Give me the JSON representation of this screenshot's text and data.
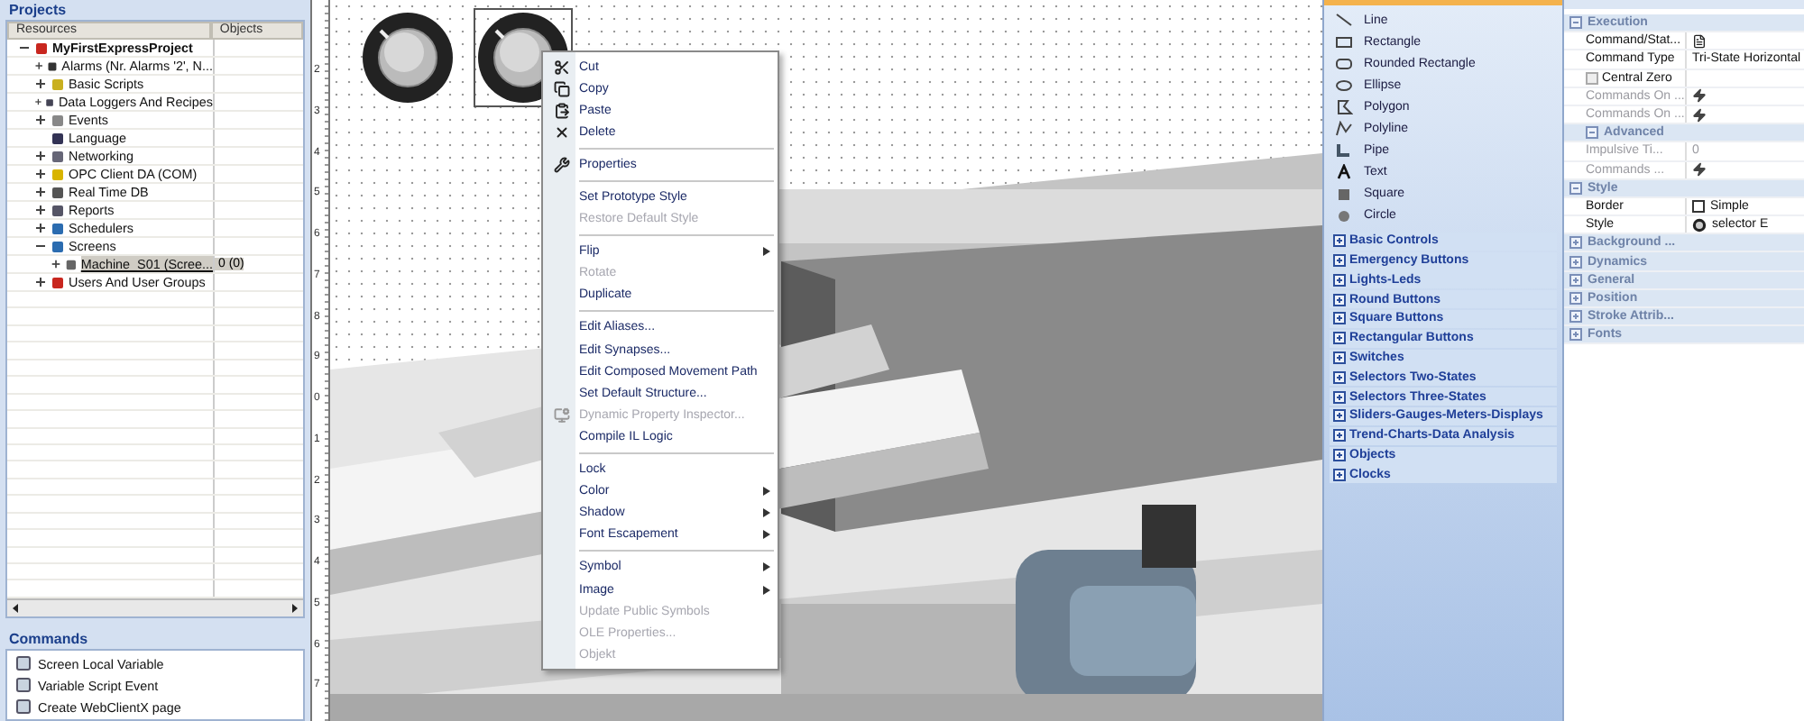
{
  "projects": {
    "title": "Projects",
    "columns": [
      "Resources",
      "Objects"
    ],
    "tree": {
      "label": "MyFirstExpressProject",
      "expanded": true,
      "children": [
        {
          "label": "Alarms (Nr. Alarms '2', N...",
          "expanded": false
        },
        {
          "label": "Basic Scripts",
          "expanded": false
        },
        {
          "label": "Data Loggers And Recipes",
          "expanded": false
        },
        {
          "label": "Events",
          "expanded": false
        },
        {
          "label": "Language"
        },
        {
          "label": "Networking",
          "expanded": false
        },
        {
          "label": "OPC Client DA (COM)",
          "expanded": false
        },
        {
          "label": "Real Time DB",
          "expanded": false
        },
        {
          "label": "Reports",
          "expanded": false
        },
        {
          "label": "Schedulers",
          "expanded": false
        },
        {
          "label": "Screens",
          "expanded": true,
          "children": [
            {
              "label": "Machine_S01 (Scree...",
              "objects": "0 (0)",
              "expanded": false,
              "selected": true
            }
          ]
        },
        {
          "label": "Users And User Groups",
          "expanded": false
        }
      ]
    }
  },
  "commands": {
    "title": "Commands",
    "items": [
      "Screen Local Variable",
      "Variable Script Event",
      "Create WebClientX page"
    ]
  },
  "ruler": [
    "2",
    "3",
    "4",
    "5",
    "6",
    "7",
    "8",
    "9",
    "0",
    "1",
    "2",
    "3",
    "4",
    "5",
    "6",
    "7"
  ],
  "canvas": {
    "knobs": [
      {
        "selected": false
      },
      {
        "selected": true
      }
    ]
  },
  "context_menu": [
    [
      {
        "label": "Cut",
        "disabled": false
      },
      {
        "label": "Copy",
        "disabled": false
      },
      {
        "label": "Paste",
        "disabled": false
      },
      {
        "label": "Delete",
        "disabled": false
      }
    ],
    [
      {
        "label": "Properties",
        "disabled": false
      }
    ],
    [
      {
        "label": "Set Prototype Style",
        "disabled": false
      },
      {
        "label": "Restore Default Style",
        "disabled": true
      }
    ],
    [
      {
        "label": "Flip",
        "disabled": false,
        "submenu": true
      },
      {
        "label": "Rotate",
        "disabled": true
      },
      {
        "label": "Duplicate",
        "disabled": false
      }
    ],
    [
      {
        "label": "Edit Aliases...",
        "disabled": false
      },
      {
        "label": "Edit Synapses...",
        "disabled": false
      },
      {
        "label": "Edit Composed Movement Path",
        "disabled": false
      },
      {
        "label": "Set Default Structure...",
        "disabled": false
      },
      {
        "label": "Dynamic Property Inspector...",
        "disabled": true
      },
      {
        "label": "Compile IL Logic",
        "disabled": false
      }
    ],
    [
      {
        "label": "Lock",
        "disabled": false
      },
      {
        "label": "Color",
        "disabled": false,
        "submenu": true
      },
      {
        "label": "Shadow",
        "disabled": false,
        "submenu": true
      },
      {
        "label": "Font Escapement",
        "disabled": false,
        "submenu": true
      }
    ],
    [
      {
        "label": "Symbol",
        "disabled": false,
        "submenu": true
      },
      {
        "label": "Image",
        "disabled": false,
        "submenu": true
      },
      {
        "label": "Update Public Symbols",
        "disabled": true
      },
      {
        "label": "OLE Properties...",
        "disabled": true
      },
      {
        "label": "Objekt",
        "disabled": true
      }
    ]
  ],
  "toolbox": {
    "shapes": [
      "Line",
      "Rectangle",
      "Rounded Rectangle",
      "Ellipse",
      "Polygon",
      "Polyline",
      "Pipe",
      "Text",
      "Square",
      "Circle"
    ],
    "categories": [
      "Basic Controls",
      "Emergency Buttons",
      "Lights-Leds",
      "Round Buttons",
      "Square Buttons",
      "Rectangular Buttons",
      "Switches",
      "Selectors Two-States",
      "Selectors Three-States",
      "Sliders-Gauges-Meters-Displays",
      "Trend-Charts-Data Analysis",
      "Objects",
      "Clocks"
    ]
  },
  "properties": [
    {
      "kind": "category",
      "label": "Execution",
      "expanded": true
    },
    {
      "kind": "file",
      "name": "Command/Stat...",
      "disabled": false
    },
    {
      "kind": "text",
      "name": "Command Type",
      "value": "Tri-State Horizontal",
      "disabled": false
    },
    {
      "kind": "checkbox",
      "name": "Central Zero",
      "checked": false,
      "disabled": false
    },
    {
      "kind": "event",
      "name": "Commands On ...",
      "disabled": true
    },
    {
      "kind": "event",
      "name": "Commands On ...",
      "disabled": true
    },
    {
      "kind": "subcategory",
      "label": "Advanced",
      "expanded": true
    },
    {
      "kind": "text",
      "name": "Impulsive Ti...",
      "value": "0",
      "disabled": true,
      "indent": true
    },
    {
      "kind": "event",
      "name": "Commands ...",
      "disabled": true,
      "indent": true
    },
    {
      "kind": "category",
      "label": "Style",
      "expanded": true
    },
    {
      "kind": "border",
      "name": "Border",
      "value": "Simple",
      "disabled": false
    },
    {
      "kind": "style",
      "name": "Style",
      "value": "selector E",
      "disabled": false
    },
    {
      "kind": "category",
      "label": "Background ...",
      "expanded": false
    },
    {
      "kind": "category",
      "label": "Dynamics",
      "expanded": false
    },
    {
      "kind": "category",
      "label": "General",
      "expanded": false
    },
    {
      "kind": "category",
      "label": "Position",
      "expanded": false
    },
    {
      "kind": "category",
      "label": "Stroke Attrib...",
      "expanded": false
    },
    {
      "kind": "category",
      "label": "Fonts",
      "expanded": false
    }
  ]
}
